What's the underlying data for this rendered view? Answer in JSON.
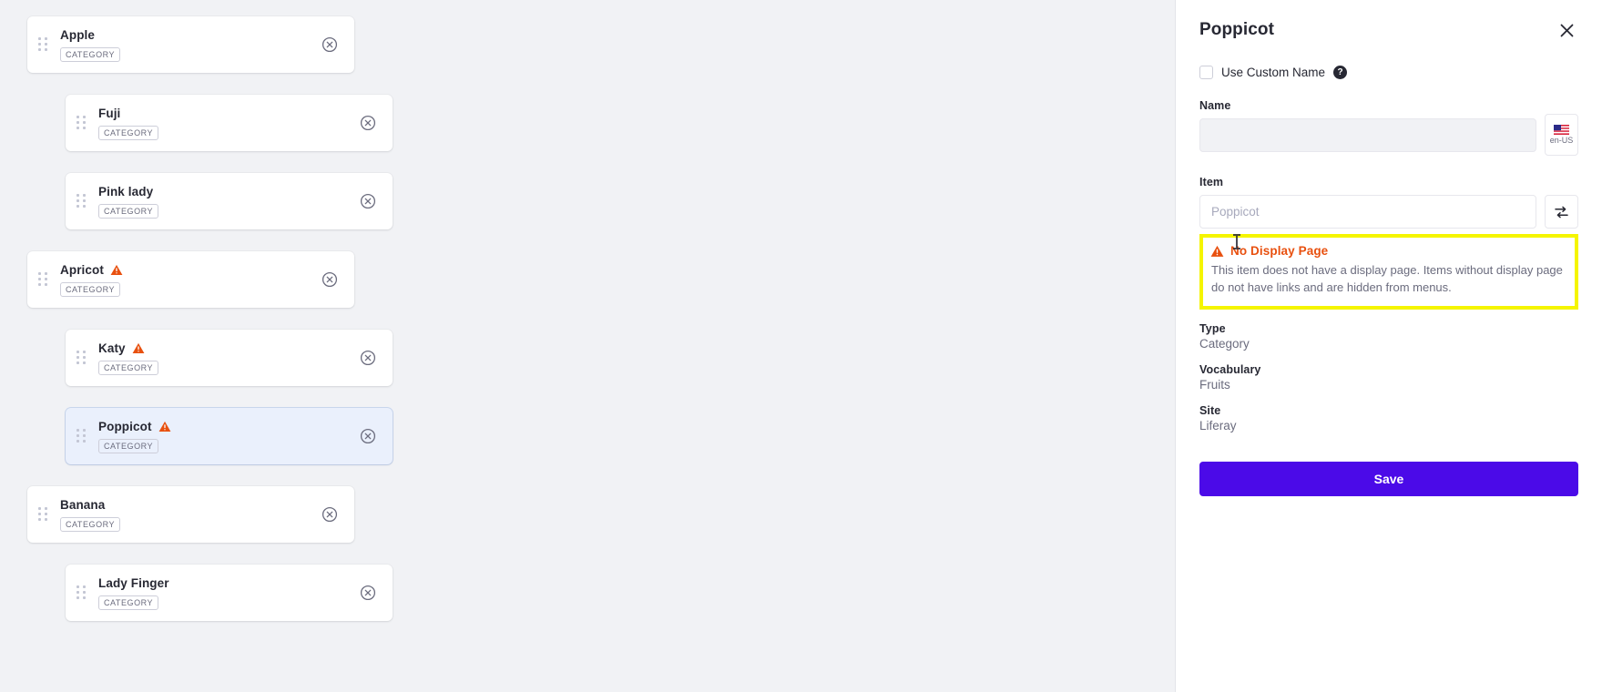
{
  "canvas": {
    "items": [
      {
        "name": "Apple",
        "badge": "CATEGORY",
        "level": 0,
        "warning": false,
        "selected": false
      },
      {
        "name": "Fuji",
        "badge": "CATEGORY",
        "level": 1,
        "warning": false,
        "selected": false
      },
      {
        "name": "Pink lady",
        "badge": "CATEGORY",
        "level": 1,
        "warning": false,
        "selected": false
      },
      {
        "name": "Apricot",
        "badge": "CATEGORY",
        "level": 0,
        "warning": true,
        "selected": false
      },
      {
        "name": "Katy",
        "badge": "CATEGORY",
        "level": 1,
        "warning": true,
        "selected": false
      },
      {
        "name": "Poppicot",
        "badge": "CATEGORY",
        "level": 1,
        "warning": true,
        "selected": true
      },
      {
        "name": "Banana",
        "badge": "CATEGORY",
        "level": 0,
        "warning": false,
        "selected": false
      },
      {
        "name": "Lady Finger",
        "badge": "CATEGORY",
        "level": 1,
        "warning": false,
        "selected": false
      }
    ]
  },
  "sidebar": {
    "title": "Poppicot",
    "close_label": "✕",
    "custom_name": {
      "label": "Use Custom Name",
      "checked": false,
      "help_glyph": "?"
    },
    "name_field": {
      "label": "Name",
      "value": "",
      "placeholder": "",
      "locale": "en-US"
    },
    "item_field": {
      "label": "Item",
      "value": "",
      "placeholder": "Poppicot"
    },
    "alert": {
      "title": "No Display Page",
      "body": "This item does not have a display page. Items without display page do not have links and are hidden from menus."
    },
    "meta": [
      {
        "label": "Type",
        "value": "Category"
      },
      {
        "label": "Vocabulary",
        "value": "Fruits"
      },
      {
        "label": "Site",
        "value": "Liferay"
      }
    ],
    "save_label": "Save"
  },
  "colors": {
    "accent": "#4b0ae8",
    "warning": "#e8500f",
    "highlight": "#f5f500",
    "selected_card": "#eaf0fc",
    "canvas_bg": "#f1f2f5"
  }
}
